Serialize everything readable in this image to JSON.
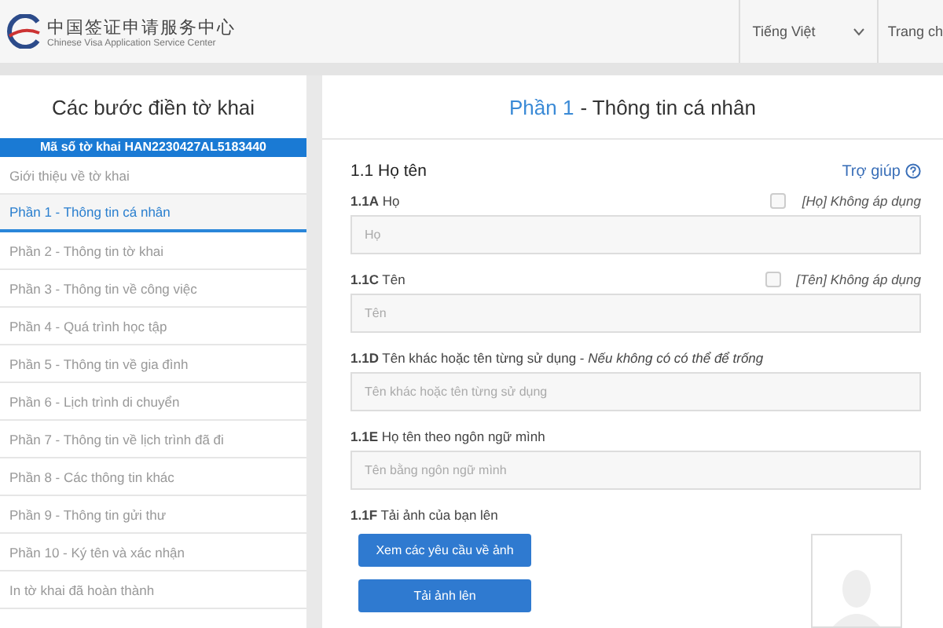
{
  "header": {
    "logo_title": "中国签证申请服务中心",
    "logo_subtitle": "Chinese Visa Application Service Center",
    "language": "Tiếng Việt",
    "nav_link": "Trang ch"
  },
  "sidebar": {
    "title": "Các bước điền tờ khai",
    "application_code": "Mã số tờ khai HAN2230427AL5183440",
    "steps": [
      {
        "label": "Giới thiệu về tờ khai",
        "selected": false
      },
      {
        "label": "Phần 1 - Thông tin cá nhân",
        "selected": true
      },
      {
        "label": "Phần 2 - Thông tin tờ khai",
        "selected": false
      },
      {
        "label": "Phần 3 - Thông tin về công việc",
        "selected": false
      },
      {
        "label": "Phần 4 - Quá trình học tập",
        "selected": false
      },
      {
        "label": "Phần 5 - Thông tin về gia đình",
        "selected": false
      },
      {
        "label": "Phần 6 - Lịch trình di chuyển",
        "selected": false
      },
      {
        "label": "Phần 7 - Thông tin về lịch trình đã đi",
        "selected": false
      },
      {
        "label": "Phần 8 - Các thông tin khác",
        "selected": false
      },
      {
        "label": "Phần 9 - Thông tin gửi thư",
        "selected": false
      },
      {
        "label": "Phần 10 - Ký tên và xác nhận",
        "selected": false
      },
      {
        "label": "In tờ khai đã hoàn thành",
        "selected": false
      }
    ]
  },
  "form": {
    "part_number": "Phần 1",
    "part_title": "- Thông tin cá nhân",
    "section_title": "1.1 Họ tên",
    "help_link": "Trợ giúp",
    "fields": [
      {
        "kind": "text",
        "label": "**1.1A** Họ",
        "na_label": "[Họ] Không áp dụng",
        "na_checked": false,
        "placeholder": "Họ"
      },
      {
        "kind": "text",
        "label": "**1.1C** Tên",
        "na_label": "[Tên] Không áp dụng",
        "na_checked": false,
        "placeholder": "Tên"
      },
      {
        "kind": "text",
        "label": "**1.1D** Tên khác hoặc tên từng sử dụng - *Nếu không có có thể để trống*",
        "placeholder": "Tên khác hoặc tên từng sử dụng"
      },
      {
        "kind": "text",
        "label": "**1.1E** Họ tên theo ngôn ngữ mình",
        "placeholder": "Tên bằng ngôn ngữ mình"
      },
      {
        "kind": "photo",
        "label": "**1.1F** Tải ảnh của bạn lên",
        "buttons": [
          "Xem các yêu cầu về ảnh",
          "Tải ảnh lên"
        ]
      }
    ]
  }
}
